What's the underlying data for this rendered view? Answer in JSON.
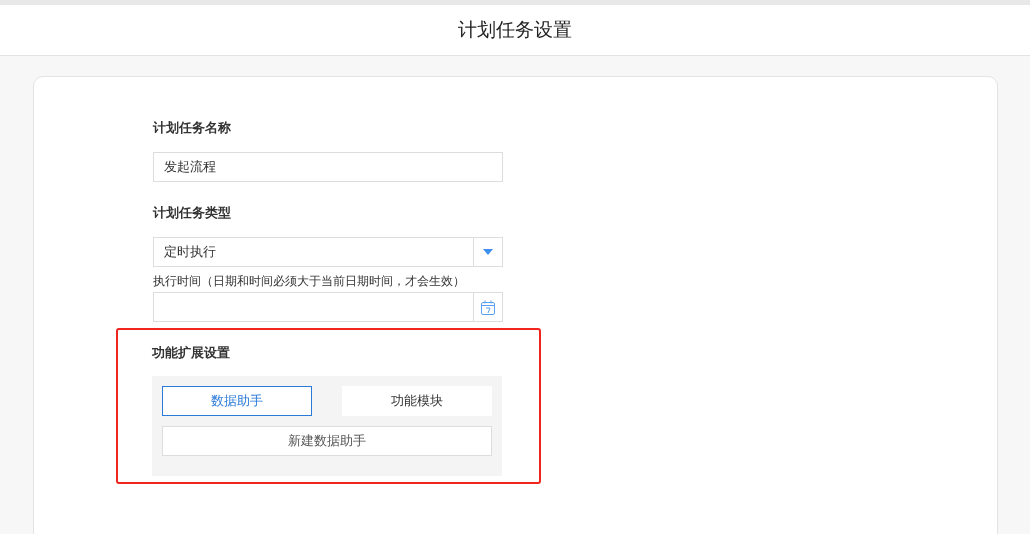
{
  "header": {
    "title": "计划任务设置"
  },
  "form": {
    "name_label": "计划任务名称",
    "name_value": "发起流程",
    "type_label": "计划任务类型",
    "type_value": "定时执行",
    "time_label": "执行时间（日期和时间必须大于当前日期时间，才会生效）"
  },
  "extension": {
    "title": "功能扩展设置",
    "tabs": [
      {
        "label": "数据助手",
        "selected": true
      },
      {
        "label": "功能模块",
        "selected": false
      }
    ],
    "new_button": "新建数据助手"
  }
}
